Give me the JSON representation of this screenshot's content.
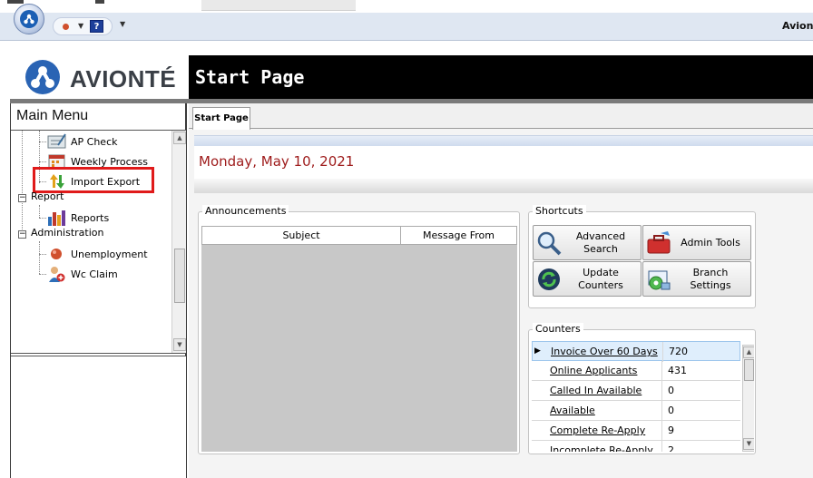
{
  "app": {
    "title_partial": "Avion",
    "logo_text": "AVIONTÉ",
    "header_title": "Start Page"
  },
  "qat": {
    "help_label": "?"
  },
  "main_menu": {
    "title": "Main Menu",
    "items": [
      {
        "label": "AP Check",
        "icon": "ap-check-icon"
      },
      {
        "label": "Weekly Process",
        "icon": "weekly-process-icon"
      },
      {
        "label": "Import Export",
        "icon": "import-export-icon"
      },
      {
        "label": "Report",
        "icon": "none",
        "group": true
      },
      {
        "label": "Reports",
        "icon": "reports-chart-icon"
      },
      {
        "label": "Administration",
        "icon": "none",
        "group": true
      },
      {
        "label": "Unemployment",
        "icon": "unemployment-icon"
      },
      {
        "label": "Wc Claim",
        "icon": "wc-claim-icon"
      }
    ]
  },
  "tabs": [
    {
      "label": "Start Page",
      "active": true
    }
  ],
  "start_page": {
    "date": "Monday, May 10, 2021"
  },
  "announcements": {
    "title": "Announcements",
    "columns": [
      "Subject",
      "Message From"
    ],
    "rows": []
  },
  "shortcuts": {
    "title": "Shortcuts",
    "buttons": [
      {
        "label": "Advanced Search",
        "icon": "magnifier-icon"
      },
      {
        "label": "Admin Tools",
        "icon": "toolbox-icon"
      },
      {
        "label": "Update Counters",
        "icon": "refresh-icon"
      },
      {
        "label": "Branch Settings",
        "icon": "branch-settings-icon"
      }
    ]
  },
  "counters": {
    "title": "Counters",
    "rows": [
      {
        "label": "Invoice Over 60 Days",
        "value": "720",
        "selected": true
      },
      {
        "label": "Online Applicants",
        "value": "431"
      },
      {
        "label": "Called In Available",
        "value": "0"
      },
      {
        "label": "Available",
        "value": "0"
      },
      {
        "label": "Complete Re-Apply",
        "value": "9"
      },
      {
        "label": "Incomplete Re-Apply",
        "value": "2"
      }
    ]
  },
  "colors": {
    "header_bg": "#000000",
    "date_text": "#9e1b1b",
    "highlight_box": "#e01a1a",
    "brand_blue": "#2a64b4"
  }
}
